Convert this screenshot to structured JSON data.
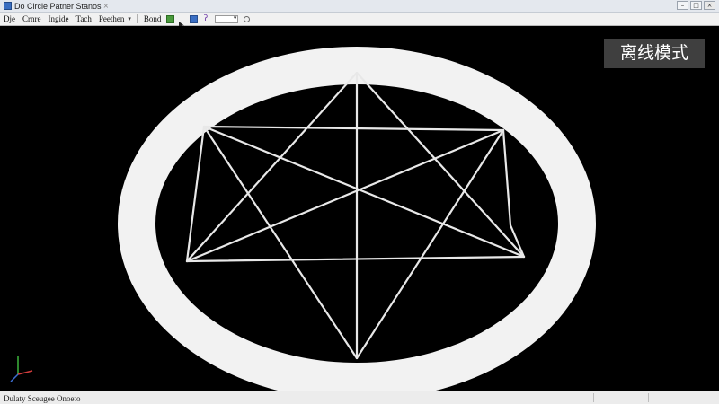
{
  "window": {
    "title": "Do Circle Patner Stanos",
    "tab_close": "×",
    "controls": {
      "minimize": "–",
      "maximize": "□",
      "close": "×"
    }
  },
  "menu": {
    "items": [
      "Dje",
      "Crnre",
      "Ingide",
      "Tach",
      "Peethen"
    ],
    "toolbar_label": "Bond"
  },
  "viewport": {
    "mode_badge": "离线模式",
    "background": "#000000",
    "ring_color": "#f2f2f2",
    "line_color": "#e8e8e8",
    "axis_colors": {
      "x": "#d23c3c",
      "y": "#3cb43c",
      "z": "#3c6ed2"
    }
  },
  "status": {
    "text": "Dulaty Sceugee Onoeto"
  }
}
